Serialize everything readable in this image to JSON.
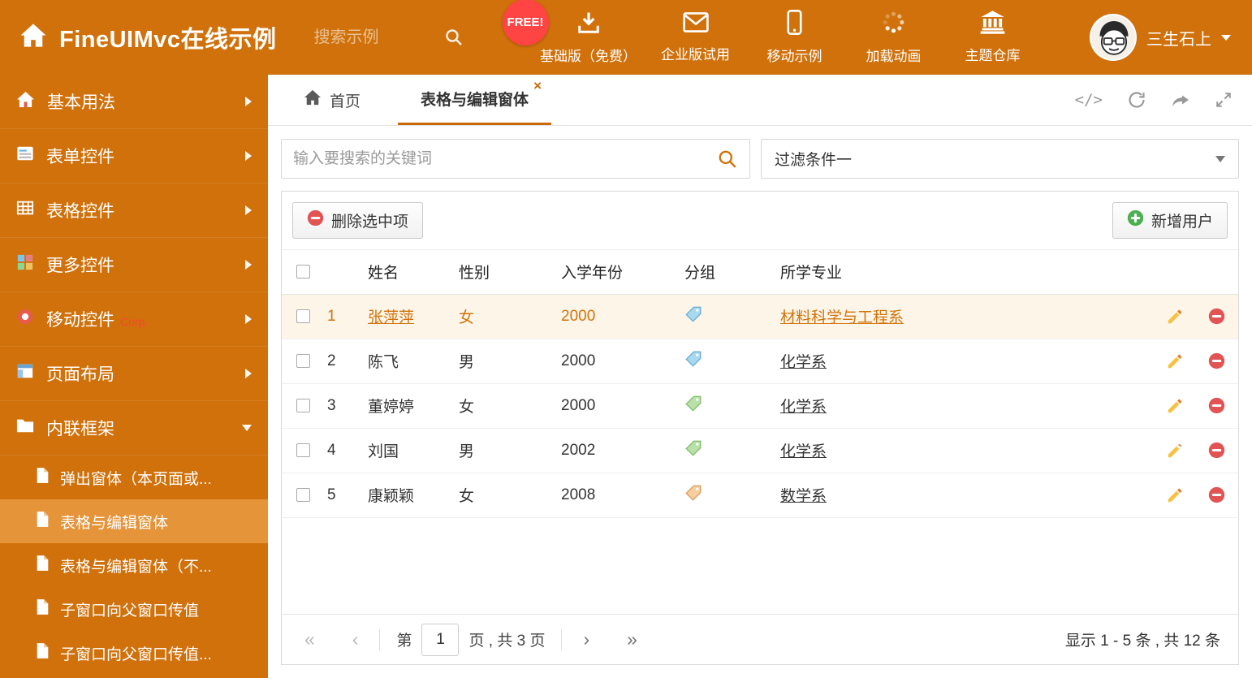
{
  "colors": {
    "accent": "#d2730b",
    "header_bg": "#d0710b",
    "sidebar_selected_bg": "#e6943a",
    "free_badge_bg": "#ff4444",
    "selected_row_bg": "#fdf5e8",
    "delete_red": "#e25454",
    "add_green": "#4caf50"
  },
  "header": {
    "title": "FineUIMvc在线示例",
    "search_placeholder": "搜索示例",
    "free_badge": "FREE!",
    "nav": [
      {
        "label": "基础版（免费）",
        "icon": "download-icon"
      },
      {
        "label": "企业版试用",
        "icon": "envelope-icon"
      },
      {
        "label": "移动示例",
        "icon": "mobile-icon"
      },
      {
        "label": "加载动画",
        "icon": "spinner-icon"
      },
      {
        "label": "主题仓库",
        "icon": "bank-icon"
      }
    ],
    "user": {
      "name": "三生石上"
    }
  },
  "sidebar": {
    "items": [
      {
        "label": "基本用法"
      },
      {
        "label": "表单控件"
      },
      {
        "label": "表格控件"
      },
      {
        "label": "更多控件"
      },
      {
        "label": "移动控件",
        "badge": "Corp."
      },
      {
        "label": "页面布局"
      },
      {
        "label": "内联框架"
      }
    ],
    "subitems": [
      {
        "label": "弹出窗体（本页面或..."
      },
      {
        "label": "表格与编辑窗体"
      },
      {
        "label": "表格与编辑窗体（不..."
      },
      {
        "label": "子窗口向父窗口传值"
      },
      {
        "label": "子窗口向父窗口传值..."
      }
    ]
  },
  "tabs": {
    "home": "首页",
    "active": "表格与编辑窗体",
    "close": "×"
  },
  "icons": {
    "code": "</>",
    "first": "«",
    "prev": "‹",
    "next": "›",
    "last": "»"
  },
  "filter": {
    "search_placeholder": "输入要搜索的关键词",
    "dropdown_value": "过滤条件一"
  },
  "toolbar": {
    "delete_label": "删除选中项",
    "add_label": "新增用户"
  },
  "table": {
    "headers": {
      "name": "姓名",
      "gender": "性别",
      "year": "入学年份",
      "group": "分组",
      "major": "所学专业"
    },
    "rows": [
      {
        "num": "1",
        "name": "张萍萍",
        "gender": "女",
        "year": "2000",
        "tag": "blue",
        "major": "材料科学与工程系",
        "selected": true
      },
      {
        "num": "2",
        "name": "陈飞",
        "gender": "男",
        "year": "2000",
        "tag": "blue",
        "major": "化学系"
      },
      {
        "num": "3",
        "name": "董婷婷",
        "gender": "女",
        "year": "2000",
        "tag": "green",
        "major": "化学系"
      },
      {
        "num": "4",
        "name": "刘国",
        "gender": "男",
        "year": "2002",
        "tag": "green",
        "major": "化学系"
      },
      {
        "num": "5",
        "name": "康颖颖",
        "gender": "女",
        "year": "2008",
        "tag": "orange",
        "major": "数学系"
      }
    ]
  },
  "pagination": {
    "prefix": "第",
    "current_page": "1",
    "suffix": "页 , 共 3 页",
    "summary": "显示 1 - 5 条 , 共 12 条"
  }
}
